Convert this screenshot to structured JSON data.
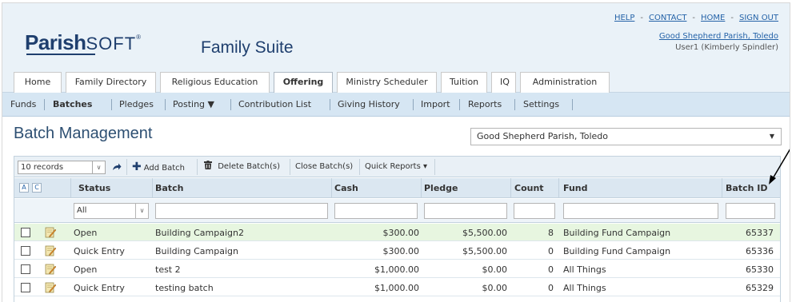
{
  "header": {
    "logo_part1": "Parish",
    "logo_part2": "SOFT",
    "logo_tm": "®",
    "suite": "Family Suite",
    "links": [
      "HELP",
      "CONTACT",
      "HOME",
      "SIGN OUT"
    ],
    "parish_link": "Good Shepherd Parish, Toledo",
    "user": "User1 (Kimberly Spindler)"
  },
  "tabs": [
    "Home",
    "Family Directory",
    "Religious Education",
    "Offering",
    "Ministry Scheduler",
    "Tuition",
    "IQ",
    "Administration"
  ],
  "subnav": [
    "Funds",
    "Batches",
    "Pledges",
    "Posting ▼",
    "Contribution List",
    "Giving History",
    "Import",
    "Reports",
    "Settings"
  ],
  "page": {
    "title": "Batch Management",
    "parish_select": "Good Shepherd Parish, Toledo"
  },
  "toolbar": {
    "records": "10 records",
    "add": "Add Batch",
    "delete": "Delete Batch(s)",
    "close": "Close Batch(s)",
    "quick_reports": "Quick Reports ▾"
  },
  "grid": {
    "ac": [
      "A",
      "C"
    ],
    "columns": [
      "Status",
      "Batch",
      "Cash",
      "Pledge",
      "Count",
      "Fund",
      "Batch ID"
    ],
    "status_filter": "All",
    "rows": [
      {
        "status": "Open",
        "batch": "Building Campaign2",
        "cash": "$300.00",
        "pledge": "$5,500.00",
        "count": "8",
        "fund": "Building Fund Campaign",
        "id": "65337"
      },
      {
        "status": "Quick Entry",
        "batch": "Building Campaign",
        "cash": "$300.00",
        "pledge": "$5,500.00",
        "count": "0",
        "fund": "Building Fund Campaign",
        "id": "65336"
      },
      {
        "status": "Open",
        "batch": "test 2",
        "cash": "$1,000.00",
        "pledge": "$0.00",
        "count": "0",
        "fund": "All Things",
        "id": "65330"
      },
      {
        "status": "Quick Entry",
        "batch": "testing batch",
        "cash": "$1,000.00",
        "pledge": "$0.00",
        "count": "0",
        "fund": "All Things",
        "id": "65329"
      }
    ]
  },
  "colors": {
    "brand": "#1f3f6e",
    "link": "#2563a8",
    "highlight_row": "#e7f6e0"
  }
}
